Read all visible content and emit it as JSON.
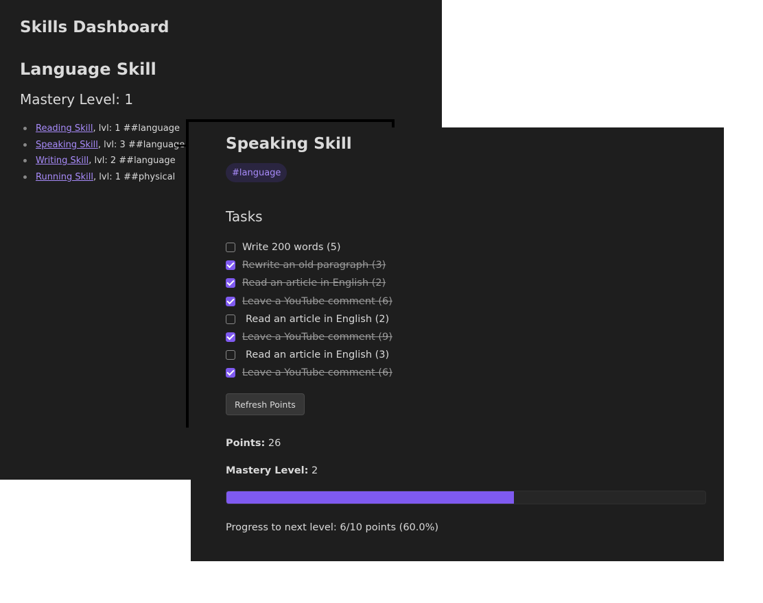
{
  "colors": {
    "background": "#1e1e1e",
    "accent": "#7f5af0",
    "link": "#a88bfa",
    "text": "#dadada"
  },
  "dashboard": {
    "title": "Skills Dashboard",
    "section_title": "Language Skill",
    "mastery": "Mastery Level: 1",
    "skills": [
      {
        "name": "Reading Skill",
        "meta": ", lvl: 1 ##language"
      },
      {
        "name": "Speaking Skill",
        "meta": ", lvl: 3 ##language"
      },
      {
        "name": "Writing Skill",
        "meta": ", lvl: 2 ##language"
      },
      {
        "name": "Running Skill",
        "meta": ", lvl: 1 ##physical"
      }
    ]
  },
  "popup": {
    "title": "Speaking Skill",
    "tag": "#language",
    "tasks_heading": "Tasks",
    "tasks": [
      {
        "label": "Write 200 words (5)",
        "done": false
      },
      {
        "label": "Rewrite an old paragraph (3)",
        "done": true
      },
      {
        "label": "Read an article in English (2)",
        "done": true
      },
      {
        "label": "Leave a YouTube comment (6)",
        "done": true
      },
      {
        "label": "Read an article in English (2)",
        "done": false
      },
      {
        "label": "Leave a YouTube comment (9)",
        "done": true
      },
      {
        "label": "Read an article in English (3)",
        "done": false
      },
      {
        "label": "Leave a YouTube comment (6)",
        "done": true
      }
    ],
    "refresh_label": "Refresh Points",
    "points_label": "Points:",
    "points_value": "26",
    "mastery_label": "Mastery Level:",
    "mastery_value": "2",
    "progress_fraction": 0.6,
    "progress_text": "Progress to next level: 6/10 points (60.0%)"
  }
}
